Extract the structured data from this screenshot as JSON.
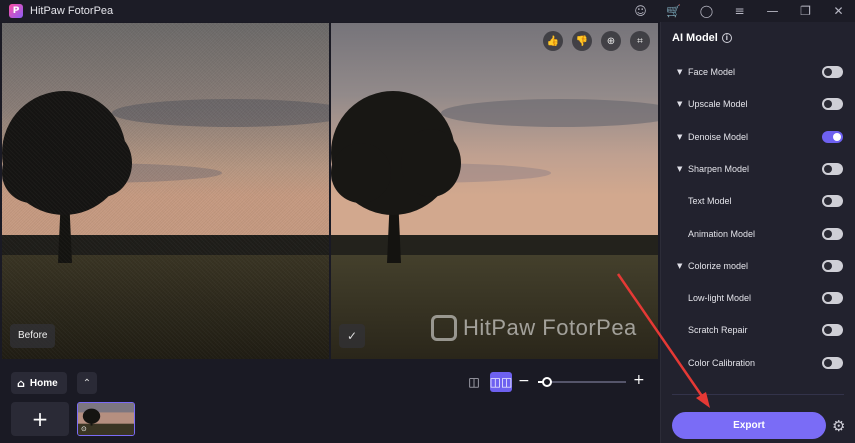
{
  "window": {
    "app_title": "HitPaw FotorPea",
    "logo_letter": "P",
    "controls": [
      {
        "name": "discord-icon",
        "glyph": "☺"
      },
      {
        "name": "cart-icon",
        "glyph": "🛒"
      },
      {
        "name": "account-icon",
        "glyph": "◯"
      },
      {
        "name": "menu-icon",
        "glyph": "≡"
      },
      {
        "name": "minimize-icon",
        "glyph": "—"
      },
      {
        "name": "restore-icon",
        "glyph": "❐"
      },
      {
        "name": "close-icon",
        "glyph": "✕"
      }
    ]
  },
  "preview": {
    "before_label": "Before",
    "after_badge_glyph": "✓",
    "watermark_text": "HitPaw FotorPea",
    "tools": [
      {
        "name": "thumbs-up-icon",
        "glyph": "👍"
      },
      {
        "name": "thumbs-down-icon",
        "glyph": "👎"
      },
      {
        "name": "zoom-icon",
        "glyph": "⊕"
      },
      {
        "name": "crop-icon",
        "glyph": "⌗"
      }
    ]
  },
  "bottom_bar": {
    "home_label": "Home",
    "home_icon": "⌂",
    "collapse_glyph": "⌃",
    "add_glyph": "+",
    "thumb_badge": "⊙",
    "view_single_glyph": "◫",
    "view_split_glyph": "◫◫",
    "zoom_minus": "−",
    "zoom_plus": "+",
    "zoom_level": 0.1
  },
  "panel": {
    "title": "AI Model",
    "info_glyph": "i",
    "models": [
      {
        "label": "Face Model",
        "caret": true,
        "on": false
      },
      {
        "label": "Upscale Model",
        "caret": true,
        "on": false
      },
      {
        "label": "Denoise Model",
        "caret": true,
        "on": true
      },
      {
        "label": "Sharpen Model",
        "caret": true,
        "on": false
      },
      {
        "label": "Text Model",
        "caret": false,
        "on": false
      },
      {
        "label": "Animation Model",
        "caret": false,
        "on": false
      },
      {
        "label": "Colorize model",
        "caret": true,
        "on": false
      },
      {
        "label": "Low-light Model",
        "caret": false,
        "on": false
      },
      {
        "label": "Scratch Repair",
        "caret": false,
        "on": false
      },
      {
        "label": "Color Calibration",
        "caret": false,
        "on": false
      }
    ],
    "export_label": "Export",
    "settings_glyph": "⚙"
  },
  "colors": {
    "accent": "#7a6cf6",
    "annotation_arrow": "#e53935"
  }
}
